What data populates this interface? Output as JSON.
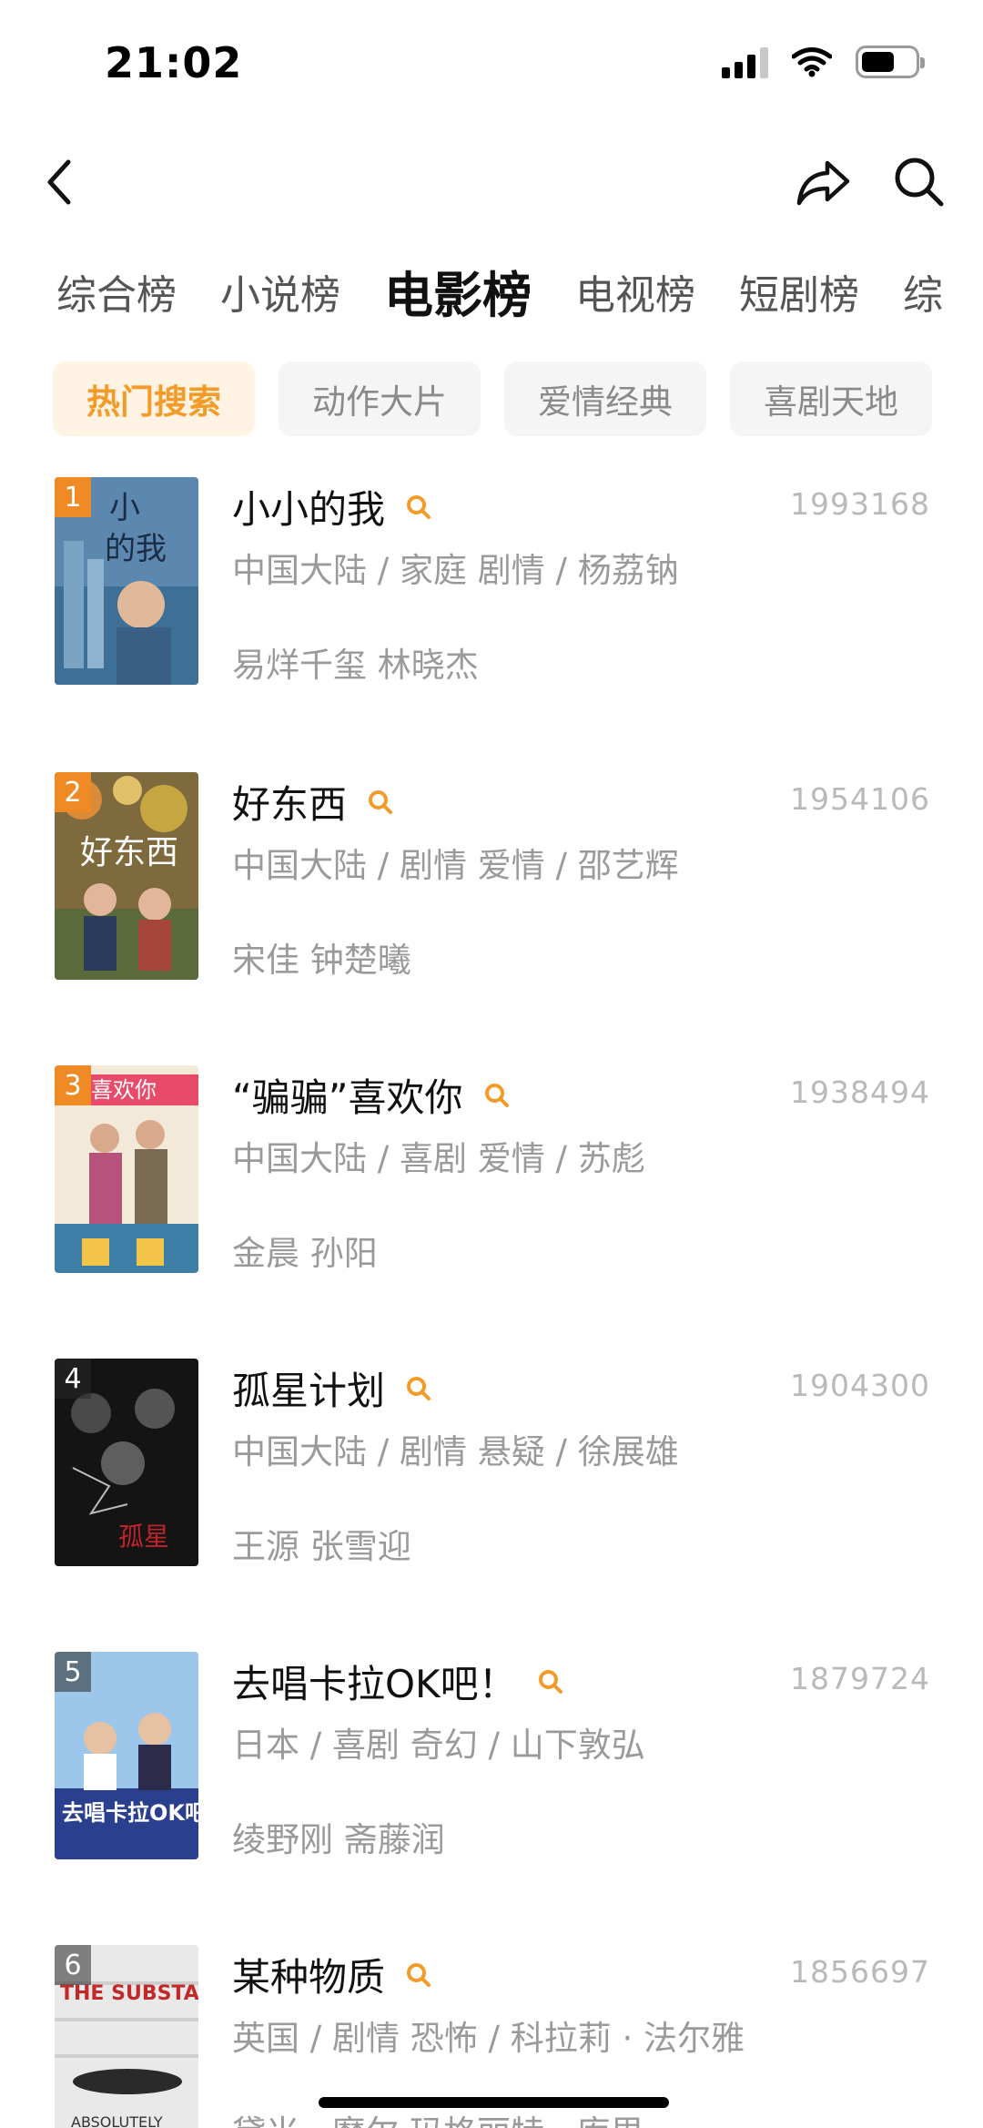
{
  "status_bar": {
    "time": "21:02",
    "battery_level": 0.62
  },
  "nav": {
    "back_icon": "chevron-left-icon",
    "share_icon": "share-icon",
    "search_icon": "search-icon"
  },
  "category_tabs": [
    {
      "label": "综合榜",
      "active": false
    },
    {
      "label": "小说榜",
      "active": false
    },
    {
      "label": "电影榜",
      "active": true
    },
    {
      "label": "电视榜",
      "active": false
    },
    {
      "label": "短剧榜",
      "active": false
    },
    {
      "label": "综",
      "active": false
    }
  ],
  "sub_tabs": [
    {
      "label": "热门搜索",
      "active": true
    },
    {
      "label": "动作大片",
      "active": false
    },
    {
      "label": "爱情经典",
      "active": false
    },
    {
      "label": "喜剧天地",
      "active": false
    }
  ],
  "colors": {
    "accent": "#f39a27",
    "badge_top": "#f08a24",
    "muted_text": "#9a9a9a"
  },
  "items": [
    {
      "rank": "1",
      "title": "小小的我",
      "count": "1993168",
      "meta": "中国大陆 / 家庭 剧情 / 杨荔钠",
      "cast": "易烊千玺 林晓杰"
    },
    {
      "rank": "2",
      "title": "好东西",
      "count": "1954106",
      "meta": "中国大陆 / 剧情 爱情 / 邵艺辉",
      "cast": "宋佳 钟楚曦"
    },
    {
      "rank": "3",
      "title": "“骗骗”喜欢你",
      "count": "1938494",
      "meta": "中国大陆 / 喜剧 爱情 / 苏彪",
      "cast": "金晨 孙阳"
    },
    {
      "rank": "4",
      "title": "孤星计划",
      "count": "1904300",
      "meta": "中国大陆 / 剧情 悬疑 / 徐展雄",
      "cast": "王源 张雪迎"
    },
    {
      "rank": "5",
      "title": "去唱卡拉OK吧！",
      "count": "1879724",
      "meta": "日本 / 喜剧 奇幻 / 山下敦弘",
      "cast": "绫野刚 斋藤润"
    },
    {
      "rank": "6",
      "title": "某种物质",
      "count": "1856697",
      "meta": "英国 / 剧情 恐怖 / 科拉莉 · 法尔雅",
      "cast": "黛米 · 摩尔 玛格丽特 · 库里"
    }
  ]
}
